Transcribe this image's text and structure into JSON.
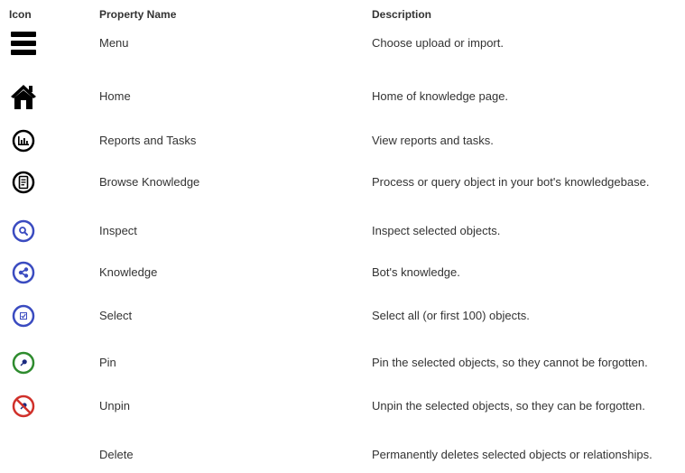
{
  "table": {
    "headers": {
      "icon": "Icon",
      "name": "Property Name",
      "description": "Description"
    },
    "rows": [
      {
        "icon": "menu-icon",
        "name": "Menu",
        "description": "Choose upload or import."
      },
      {
        "icon": "home-icon",
        "name": "Home",
        "description": "Home of knowledge page."
      },
      {
        "icon": "reports-chart-icon",
        "name": "Reports and Tasks",
        "description": "View reports and tasks."
      },
      {
        "icon": "browse-document-icon",
        "name": "Browse Knowledge",
        "description": "Process or query object in your bot's knowledgebase."
      },
      {
        "icon": "inspect-magnifier-icon",
        "name": "Inspect",
        "description": "Inspect selected objects."
      },
      {
        "icon": "share-knowledge-icon",
        "name": "Knowledge",
        "description": "Bot's knowledge."
      },
      {
        "icon": "select-checkbox-icon",
        "name": "Select",
        "description": "Select all (or first 100) objects."
      },
      {
        "icon": "pin-icon",
        "name": "Pin",
        "description": "Pin the selected objects, so they cannot be forgotten."
      },
      {
        "icon": "unpin-icon",
        "name": "Unpin",
        "description": "Unpin the selected objects, so they can be forgotten."
      },
      {
        "icon": "",
        "name": "Delete",
        "description": "Permanently deletes selected objects or relationships."
      }
    ]
  },
  "colors": {
    "text": "#333333",
    "icon_dark": "#000000",
    "icon_blue": "#3a4bc0",
    "icon_green": "#2e8b2e",
    "icon_red": "#d0302a"
  }
}
